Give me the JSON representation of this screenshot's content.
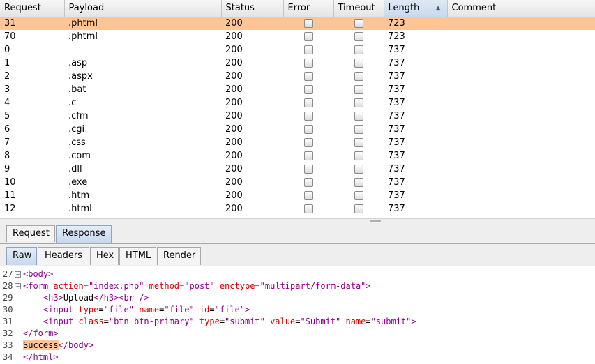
{
  "results": {
    "columns": [
      {
        "key": "request",
        "label": "Request"
      },
      {
        "key": "payload",
        "label": "Payload"
      },
      {
        "key": "status",
        "label": "Status"
      },
      {
        "key": "error",
        "label": "Error"
      },
      {
        "key": "timeout",
        "label": "Timeout"
      },
      {
        "key": "length",
        "label": "Length",
        "sorted": "ascending"
      },
      {
        "key": "comment",
        "label": "Comment"
      }
    ],
    "rows": [
      {
        "request": "31",
        "payload": ".phtml",
        "status": "200",
        "length": "723",
        "comment": "",
        "selected": true
      },
      {
        "request": "70",
        "payload": ".phtml",
        "status": "200",
        "length": "723",
        "comment": ""
      },
      {
        "request": "0",
        "payload": "",
        "status": "200",
        "length": "737",
        "comment": ""
      },
      {
        "request": "1",
        "payload": ".asp",
        "status": "200",
        "length": "737",
        "comment": ""
      },
      {
        "request": "2",
        "payload": ".aspx",
        "status": "200",
        "length": "737",
        "comment": ""
      },
      {
        "request": "3",
        "payload": ".bat",
        "status": "200",
        "length": "737",
        "comment": ""
      },
      {
        "request": "4",
        "payload": ".c",
        "status": "200",
        "length": "737",
        "comment": ""
      },
      {
        "request": "5",
        "payload": ".cfm",
        "status": "200",
        "length": "737",
        "comment": ""
      },
      {
        "request": "6",
        "payload": ".cgi",
        "status": "200",
        "length": "737",
        "comment": ""
      },
      {
        "request": "7",
        "payload": ".css",
        "status": "200",
        "length": "737",
        "comment": ""
      },
      {
        "request": "8",
        "payload": ".com",
        "status": "200",
        "length": "737",
        "comment": ""
      },
      {
        "request": "9",
        "payload": ".dll",
        "status": "200",
        "length": "737",
        "comment": ""
      },
      {
        "request": "10",
        "payload": ".exe",
        "status": "200",
        "length": "737",
        "comment": ""
      },
      {
        "request": "11",
        "payload": ".htm",
        "status": "200",
        "length": "737",
        "comment": ""
      },
      {
        "request": "12",
        "payload": ".html",
        "status": "200",
        "length": "737",
        "comment": ""
      }
    ]
  },
  "message_tabs": [
    {
      "label": "Request",
      "active": false
    },
    {
      "label": "Response",
      "active": true
    }
  ],
  "view_tabs": [
    {
      "label": "Raw",
      "active": true
    },
    {
      "label": "Headers",
      "active": false
    },
    {
      "label": "Hex",
      "active": false
    },
    {
      "label": "HTML",
      "active": false
    },
    {
      "label": "Render",
      "active": false
    }
  ],
  "code": [
    {
      "line": "27",
      "fold": "⊟",
      "indent": "",
      "segments": [
        [
          "tag",
          "<body>"
        ]
      ]
    },
    {
      "line": "28",
      "fold": "⊟",
      "indent": "",
      "segments": [
        [
          "tag",
          "<form "
        ],
        [
          "attr",
          "action"
        ],
        [
          "plain",
          "="
        ],
        [
          "val",
          "\"index.php\""
        ],
        [
          "plain",
          " "
        ],
        [
          "attr",
          "method"
        ],
        [
          "plain",
          "="
        ],
        [
          "val",
          "\"post\""
        ],
        [
          "plain",
          " "
        ],
        [
          "attr",
          "enctype"
        ],
        [
          "plain",
          "="
        ],
        [
          "val",
          "\"multipart/form-data\""
        ],
        [
          "tag",
          ">"
        ]
      ]
    },
    {
      "line": "29",
      "fold": "",
      "indent": "    ",
      "segments": [
        [
          "tag",
          "<h3>"
        ],
        [
          "plain",
          "Upload"
        ],
        [
          "tag",
          "</h3><br />"
        ]
      ]
    },
    {
      "line": "30",
      "fold": "",
      "indent": "    ",
      "segments": [
        [
          "tag",
          "<input "
        ],
        [
          "attr",
          "type"
        ],
        [
          "plain",
          "="
        ],
        [
          "val",
          "\"file\""
        ],
        [
          "plain",
          " "
        ],
        [
          "attr",
          "name"
        ],
        [
          "plain",
          "="
        ],
        [
          "val",
          "\"file\""
        ],
        [
          "plain",
          " "
        ],
        [
          "attr",
          "id"
        ],
        [
          "plain",
          "="
        ],
        [
          "val",
          "\"file\""
        ],
        [
          "tag",
          ">"
        ]
      ]
    },
    {
      "line": "31",
      "fold": "",
      "indent": "    ",
      "segments": [
        [
          "tag",
          "<input "
        ],
        [
          "attr",
          "class"
        ],
        [
          "plain",
          "="
        ],
        [
          "val",
          "\"btn btn-primary\""
        ],
        [
          "plain",
          " "
        ],
        [
          "attr",
          "type"
        ],
        [
          "plain",
          "="
        ],
        [
          "val",
          "\"submit\""
        ],
        [
          "plain",
          " "
        ],
        [
          "attr",
          "value"
        ],
        [
          "plain",
          "="
        ],
        [
          "val",
          "\"Submit\""
        ],
        [
          "plain",
          " "
        ],
        [
          "attr",
          "name"
        ],
        [
          "plain",
          "="
        ],
        [
          "val",
          "\"submit\""
        ],
        [
          "tag",
          ">"
        ]
      ]
    },
    {
      "line": "32",
      "fold": "",
      "indent": "",
      "segments": [
        [
          "tag",
          "</form>"
        ]
      ]
    },
    {
      "line": "33",
      "fold": "",
      "indent": "",
      "segments": [
        [
          "hl",
          "Success"
        ],
        [
          "tag",
          "</body>"
        ]
      ]
    },
    {
      "line": "34",
      "fold": "",
      "indent": "",
      "segments": [
        [
          "tag",
          "</html>"
        ]
      ]
    }
  ],
  "colors": {
    "selection": "#ffc599",
    "tag": "#8b008b",
    "attribute": "#d10000",
    "active_tab": "#c8d9ec"
  }
}
